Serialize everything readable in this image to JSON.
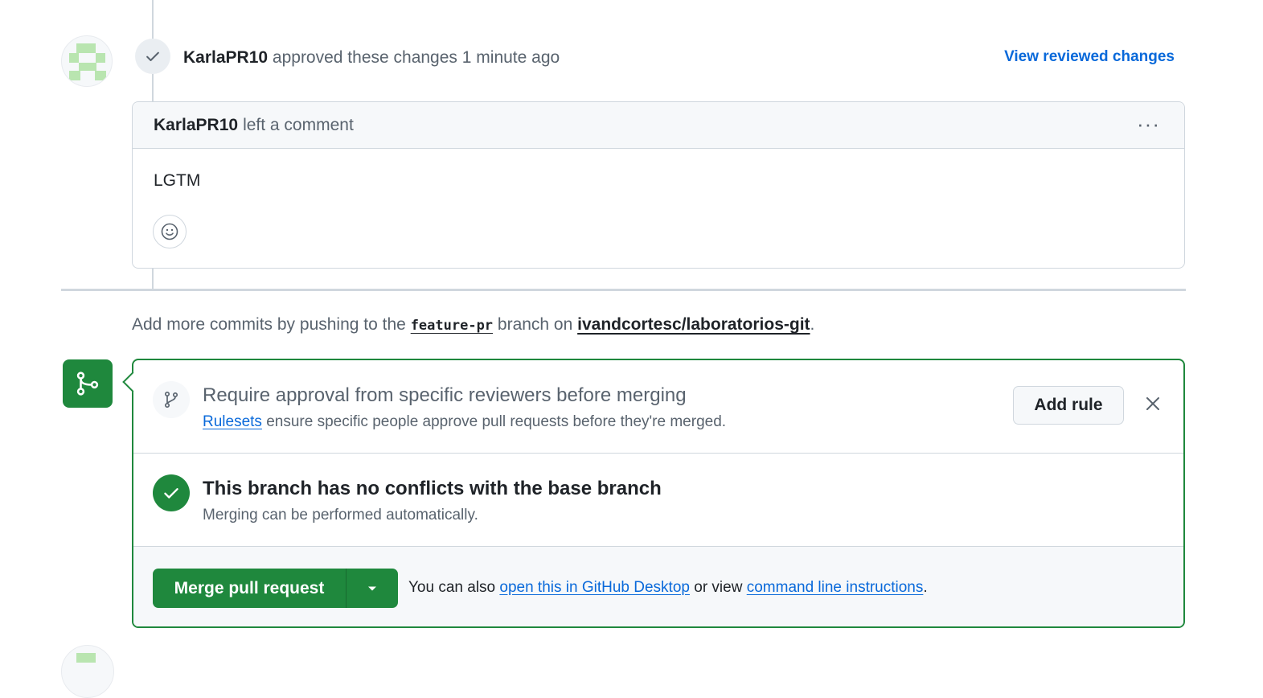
{
  "review": {
    "author": "KarlaPR10",
    "action": "approved these changes",
    "time": "1 minute ago",
    "view_link": "View reviewed changes"
  },
  "comment": {
    "author": "KarlaPR10",
    "action": "left a comment",
    "menu": "···",
    "body": "LGTM"
  },
  "commits_hint": {
    "prefix": "Add more commits by pushing to the",
    "branch": "feature-pr",
    "middle": "branch on",
    "repo": "ivandcortesc/laboratorios-git",
    "suffix": "."
  },
  "ruleset": {
    "title": "Require approval from specific reviewers before merging",
    "link": "Rulesets",
    "description": "ensure specific people approve pull requests before they're merged.",
    "button": "Add rule"
  },
  "conflicts": {
    "title": "This branch has no conflicts with the base branch",
    "subtitle": "Merging can be performed automatically."
  },
  "merge": {
    "button": "Merge pull request",
    "also_prefix": "You can also",
    "desktop_link": "open this in GitHub Desktop",
    "middle": "or view",
    "cli_link": "command line instructions",
    "suffix": "."
  },
  "colors": {
    "green": "#1f883d",
    "link": "#0969da",
    "muted": "#59636e",
    "border": "#d0d7de"
  }
}
